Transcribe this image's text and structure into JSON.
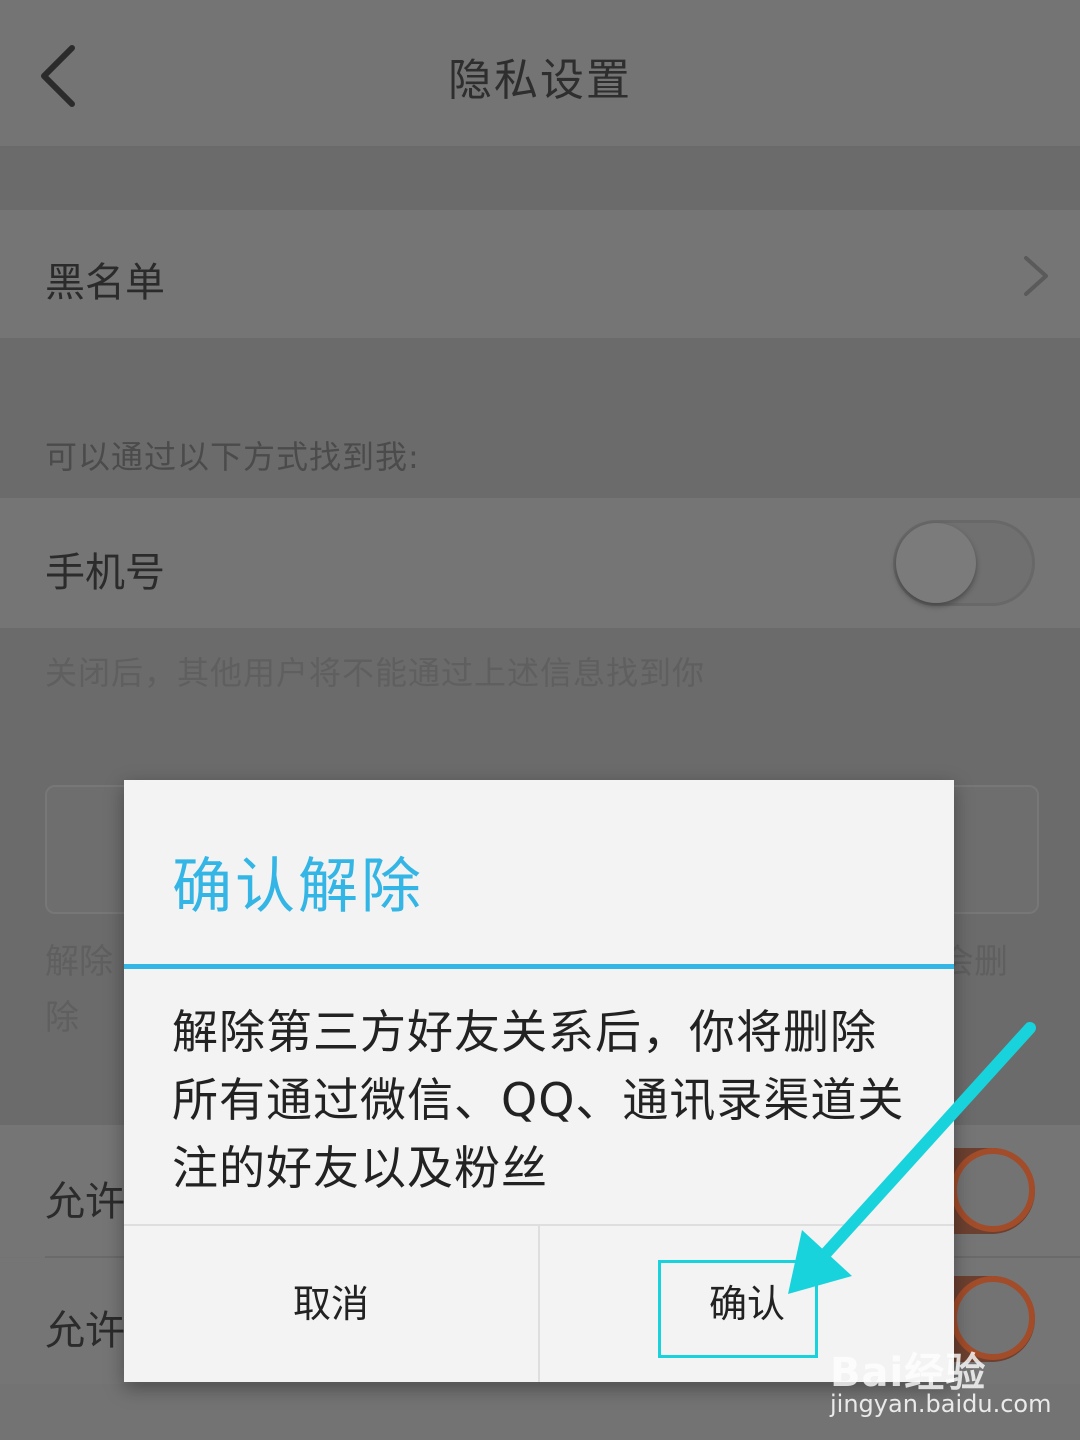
{
  "header": {
    "title": "隐私设置"
  },
  "blacklist": {
    "label": "黑名单"
  },
  "find_me": {
    "caption": "可以通过以下方式找到我:",
    "phone_label": "手机号",
    "phone_enabled": false,
    "note": "关闭后，其他用户将不能通过上述信息找到你"
  },
  "background_fragments": {
    "left_line1": "解除",
    "left_line2": "除",
    "right_line1": "会删",
    "allow_row1_label": "允许",
    "allow_row2_label": "允许",
    "allow_row1_enabled": true,
    "allow_row2_enabled": true
  },
  "dialog": {
    "title": "确认解除",
    "message": "解除第三方好友关系后，你将删除所有通过微信、QQ、通讯录渠道关注的好友以及粉丝",
    "cancel_label": "取消",
    "confirm_label": "确认"
  },
  "colors": {
    "accent": "#33b5e5",
    "highlight": "#19d3dc",
    "toggle_on": "#a24c2a"
  },
  "watermark": {
    "main": "Bai经验",
    "sub": "jingyan.baidu.com"
  }
}
